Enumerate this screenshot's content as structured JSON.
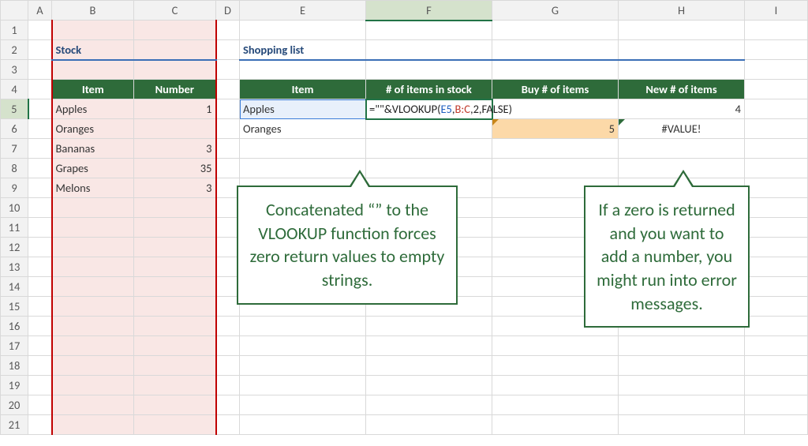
{
  "columns": [
    "A",
    "B",
    "C",
    "D",
    "E",
    "F",
    "G",
    "H",
    "I"
  ],
  "rows": [
    "1",
    "2",
    "3",
    "4",
    "5",
    "6",
    "7",
    "8",
    "9",
    "10",
    "11",
    "12",
    "13",
    "14",
    "15",
    "16",
    "17",
    "18",
    "19",
    "20",
    "21"
  ],
  "stock": {
    "title": "Stock",
    "headers": {
      "item": "Item",
      "number": "Number"
    },
    "rows": [
      {
        "item": "Apples",
        "number": "1"
      },
      {
        "item": "Oranges",
        "number": ""
      },
      {
        "item": "Bananas",
        "number": "3"
      },
      {
        "item": "Grapes",
        "number": "35"
      },
      {
        "item": "Melons",
        "number": "3"
      }
    ]
  },
  "shopping": {
    "title": "Shopping list",
    "headers": {
      "item": "Item",
      "stock": "# of items in stock",
      "buy": "Buy # of items",
      "new": "New # of items"
    },
    "rows": [
      {
        "item": "Apples",
        "buy": "",
        "new": "4"
      },
      {
        "item": "Oranges",
        "buy": "5",
        "new": "#VALUE!"
      }
    ]
  },
  "formula": {
    "prefix": "=\"\"&VLOOKUP(",
    "arg1": "E5",
    "sep1": ",",
    "arg2": "B:C",
    "sep2": ",2,FALSE)"
  },
  "callouts": {
    "left": "Concatenated “” to the VLOOKUP function forces zero return values to empty strings.",
    "right": "If a zero is returned and you want to add a number, you might run into error messages."
  },
  "active": {
    "col": "F",
    "row": "5"
  }
}
